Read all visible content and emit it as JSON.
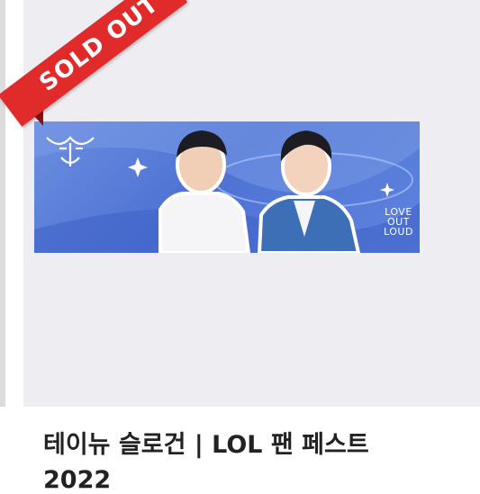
{
  "badge": {
    "label": "SOLD OUT"
  },
  "banner": {
    "logo_line1": "LOVE",
    "logo_line2": "OUT",
    "logo_line3": "LOUD"
  },
  "product": {
    "title": "테이뉴 슬로건 | LOL 팬 페스트",
    "title_line2": "2022"
  },
  "colors": {
    "ribbon": "#e12a2a",
    "banner": "#5a7edb",
    "background": "#eeeef2"
  }
}
